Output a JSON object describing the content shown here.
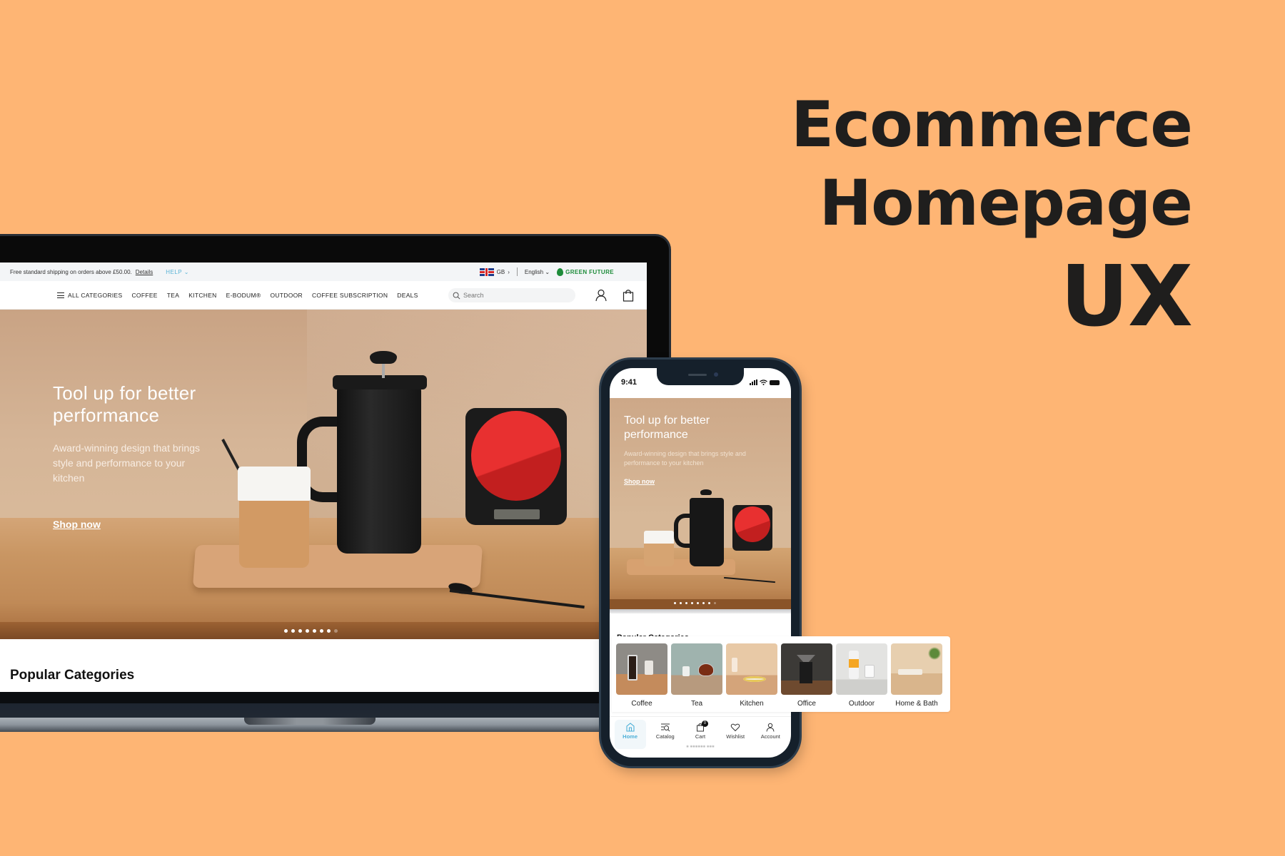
{
  "headline": {
    "line1": "Ecommerce",
    "line2": "Homepage",
    "line3": "UX"
  },
  "colors": {
    "background": "#FEB574",
    "headline": "#1F1E1D",
    "accent_green": "#1E8C3A",
    "accent_blue": "#4EB0D8",
    "scale_red": "#E83030"
  },
  "desktop": {
    "topbar": {
      "shipping_text": "Free standard shipping on orders above £50.00.",
      "details_link": "Details",
      "help_label": "HELP",
      "region": "GB",
      "language": "English",
      "green_future": "GREEN FUTURE"
    },
    "nav": {
      "items": [
        {
          "label": "ALL CATEGORIES",
          "icon": "hamburger-icon"
        },
        {
          "label": "COFFEE"
        },
        {
          "label": "TEA"
        },
        {
          "label": "KITCHEN"
        },
        {
          "label": "E-BODUM®"
        },
        {
          "label": "OUTDOOR"
        },
        {
          "label": "COFFEE SUBSCRIPTION"
        },
        {
          "label": "DEALS"
        }
      ],
      "search_placeholder": "Search",
      "account_icon": "user-icon",
      "cart_icon": "shopping-bag-icon"
    },
    "hero": {
      "title": "Tool up for better performance",
      "description": "Award-winning design that brings style and performance to your kitchen",
      "cta": "Shop now",
      "slides_total": 8,
      "active_slides_shown": 7
    },
    "section_title": "Popular Categories"
  },
  "mobile": {
    "status": {
      "time": "9:41"
    },
    "hero": {
      "title": "Tool up for better performance",
      "description": "Award-winning design that brings style and performance to your kitchen",
      "cta": "Shop now"
    },
    "section_title": "Popular Categories",
    "categories": [
      {
        "label": "Coffee"
      },
      {
        "label": "Tea"
      },
      {
        "label": "Kitchen"
      },
      {
        "label": "Office"
      },
      {
        "label": "Outdoor"
      },
      {
        "label": "Home & Bath"
      }
    ],
    "tabbar": [
      {
        "label": "Home",
        "icon": "home-icon",
        "active": true
      },
      {
        "label": "Catalog",
        "icon": "catalog-search-icon"
      },
      {
        "label": "Cart",
        "icon": "cart-bag-icon",
        "badge": "0"
      },
      {
        "label": "Wishlist",
        "icon": "heart-icon"
      },
      {
        "label": "Account",
        "icon": "user-icon"
      }
    ]
  }
}
